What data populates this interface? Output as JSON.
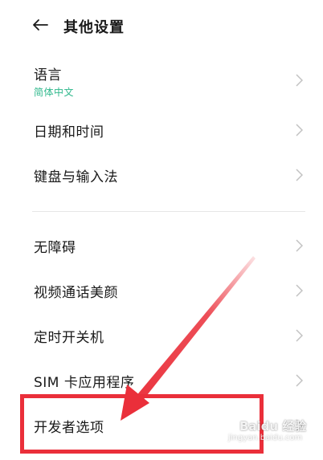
{
  "header": {
    "title": "其他设置",
    "back_icon": "arrow-left-icon"
  },
  "items": [
    {
      "label": "语言",
      "sub": "简体中文"
    },
    {
      "label": "日期和时间"
    },
    {
      "label": "键盘与输入法"
    },
    {
      "label": "无障碍"
    },
    {
      "label": "视频通话美颜"
    },
    {
      "label": "定时开关机"
    },
    {
      "label": "SIM 卡应用程序"
    },
    {
      "label": "开发者选项"
    }
  ],
  "colors": {
    "sub_text": "#2fb88c",
    "annotation": "#ea2f3a",
    "chevron": "#c2c2c2"
  },
  "watermark": {
    "logo_text": "Baidu 经验",
    "url_text": "jingyan.baidu.com"
  }
}
